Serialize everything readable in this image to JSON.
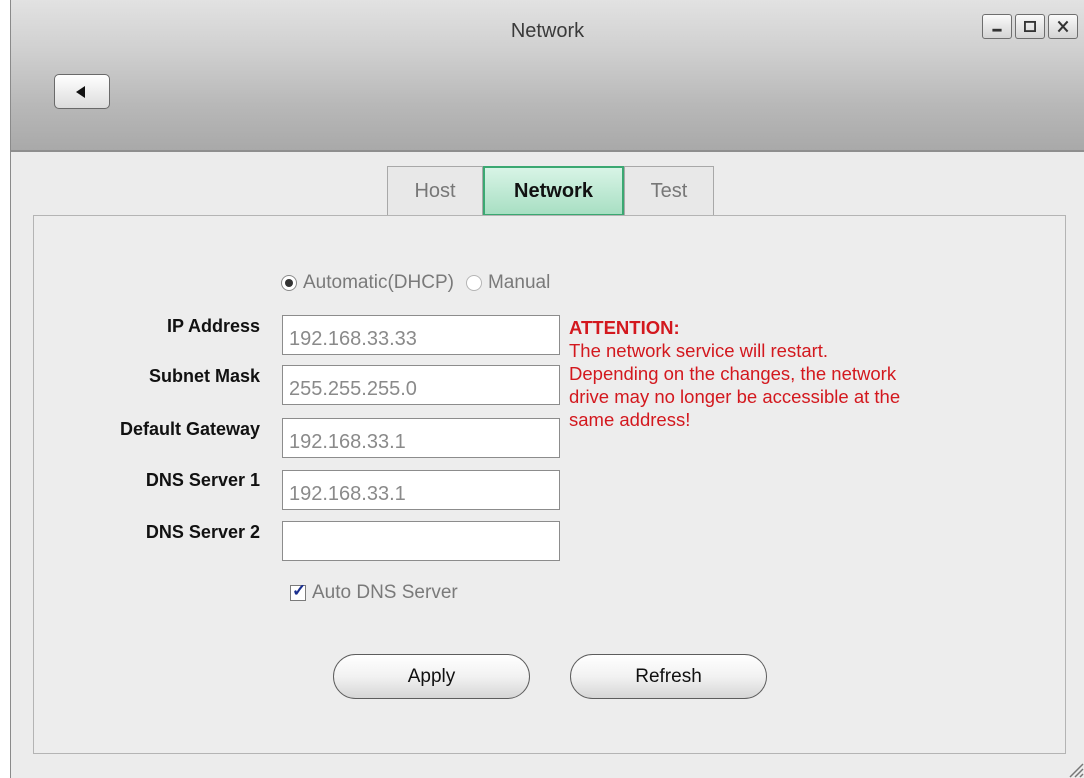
{
  "window": {
    "title": "Network",
    "controls": {
      "minimize_icon": "minimize-icon",
      "maximize_icon": "maximize-icon",
      "close_icon": "close-icon"
    },
    "back_icon": "back-arrow-icon"
  },
  "tabs": [
    {
      "label": "Host",
      "active": false
    },
    {
      "label": "Network",
      "active": true
    },
    {
      "label": "Test",
      "active": false
    }
  ],
  "mode": {
    "options": [
      "Automatic(DHCP)",
      "Manual"
    ],
    "selected": "Automatic(DHCP)"
  },
  "fields": {
    "ip_address": {
      "label": "IP Address",
      "value": "192.168.33.33"
    },
    "subnet_mask": {
      "label": "Subnet Mask",
      "value": "255.255.255.0"
    },
    "default_gateway": {
      "label": "Default Gateway",
      "value": "192.168.33.1"
    },
    "dns_server_1": {
      "label": "DNS Server 1",
      "value": "192.168.33.1"
    },
    "dns_server_2": {
      "label": "DNS Server 2",
      "value": ""
    }
  },
  "warning": {
    "heading": "ATTENTION:",
    "line1": "The network service will restart.",
    "line2": "Depending on the changes, the network",
    "line3": "drive may no longer be accessible at the",
    "line4": "same address!",
    "color": "#d3181e"
  },
  "auto_dns": {
    "label": "Auto DNS Server",
    "checked": true
  },
  "buttons": {
    "apply": "Apply",
    "refresh": "Refresh"
  },
  "colors": {
    "active_tab": "#a8dfc3",
    "active_tab_border": "#3ba872"
  }
}
